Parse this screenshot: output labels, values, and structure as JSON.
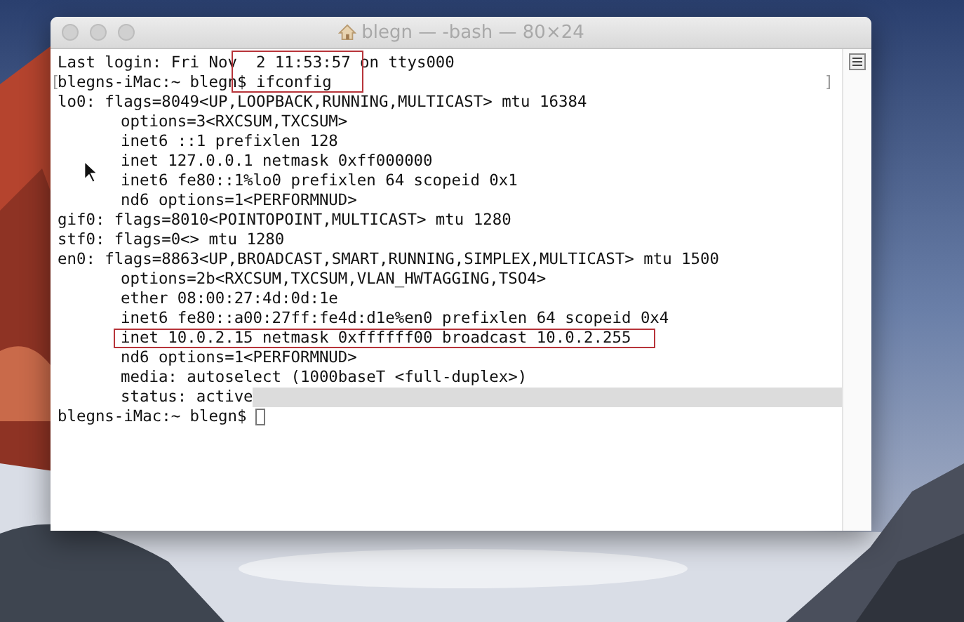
{
  "window": {
    "title": "blegn — -bash — 80×24",
    "active": false
  },
  "terminal": {
    "lines": [
      {
        "segments": [
          {
            "text": "Last login: Fri Nov"
          },
          {
            "text": "  2 11:53:57 ",
            "boxed": true
          },
          {
            "text": "on ttys000"
          }
        ]
      },
      {
        "marks": [
          "[",
          "]"
        ],
        "segments": [
          {
            "text": "blegns-iMac:~ blegn"
          },
          {
            "text": "$ ifconfig",
            "boxed": true
          }
        ]
      },
      {
        "segments": [
          {
            "text": "lo0: flags=8049<UP,LOOPBACK,RUNNING,MULTICAST> mtu 16384"
          }
        ]
      },
      {
        "indent": true,
        "segments": [
          {
            "text": "options=3<RXCSUM,TXCSUM>"
          }
        ]
      },
      {
        "indent": true,
        "segments": [
          {
            "text": "inet6 ::1 prefixlen 128"
          }
        ]
      },
      {
        "indent": true,
        "segments": [
          {
            "text": "inet 127.0.0.1 netmask 0xff000000"
          }
        ]
      },
      {
        "indent": true,
        "segments": [
          {
            "text": "inet6 fe80::1%lo0 prefixlen 64 scopeid 0x1"
          }
        ]
      },
      {
        "indent": true,
        "segments": [
          {
            "text": "nd6 options=1<PERFORMNUD>"
          }
        ]
      },
      {
        "segments": [
          {
            "text": "gif0: flags=8010<POINTOPOINT,MULTICAST> mtu 1280"
          }
        ]
      },
      {
        "segments": [
          {
            "text": "stf0: flags=0<> mtu 1280"
          }
        ]
      },
      {
        "segments": [
          {
            "text": "en0: flags=8863<UP,BROADCAST,SMART,RUNNING,SIMPLEX,MULTICAST> mtu 1500"
          }
        ]
      },
      {
        "indent": true,
        "segments": [
          {
            "text": "options=2b<RXCSUM,TXCSUM,VLAN_HWTAGGING,TSO4>"
          }
        ]
      },
      {
        "indent": true,
        "segments": [
          {
            "text": "ether 08:00:27:4d:0d:1e"
          }
        ]
      },
      {
        "indent": true,
        "segments": [
          {
            "text": "inet6 fe80::a00:27ff:fe4d:d1e%en0 prefixlen 64 scopeid 0x4"
          }
        ]
      },
      {
        "indent": true,
        "segments": [
          {
            "text": "inet 10.0.2.15 netmask 0xffffff00 broadcast 10.0.2.255",
            "boxed": true
          }
        ]
      },
      {
        "indent": true,
        "segments": [
          {
            "text": "nd6 options=1<PERFORMNUD>"
          }
        ]
      },
      {
        "indent": true,
        "segments": [
          {
            "text": "media: autoselect (1000baseT <full-duplex>)"
          }
        ]
      },
      {
        "indent": true,
        "selection_tail": true,
        "segments": [
          {
            "text": "status: active"
          }
        ]
      },
      {
        "cursor": true,
        "segments": [
          {
            "text": "blegns-iMac:~ blegn$"
          }
        ]
      }
    ]
  }
}
